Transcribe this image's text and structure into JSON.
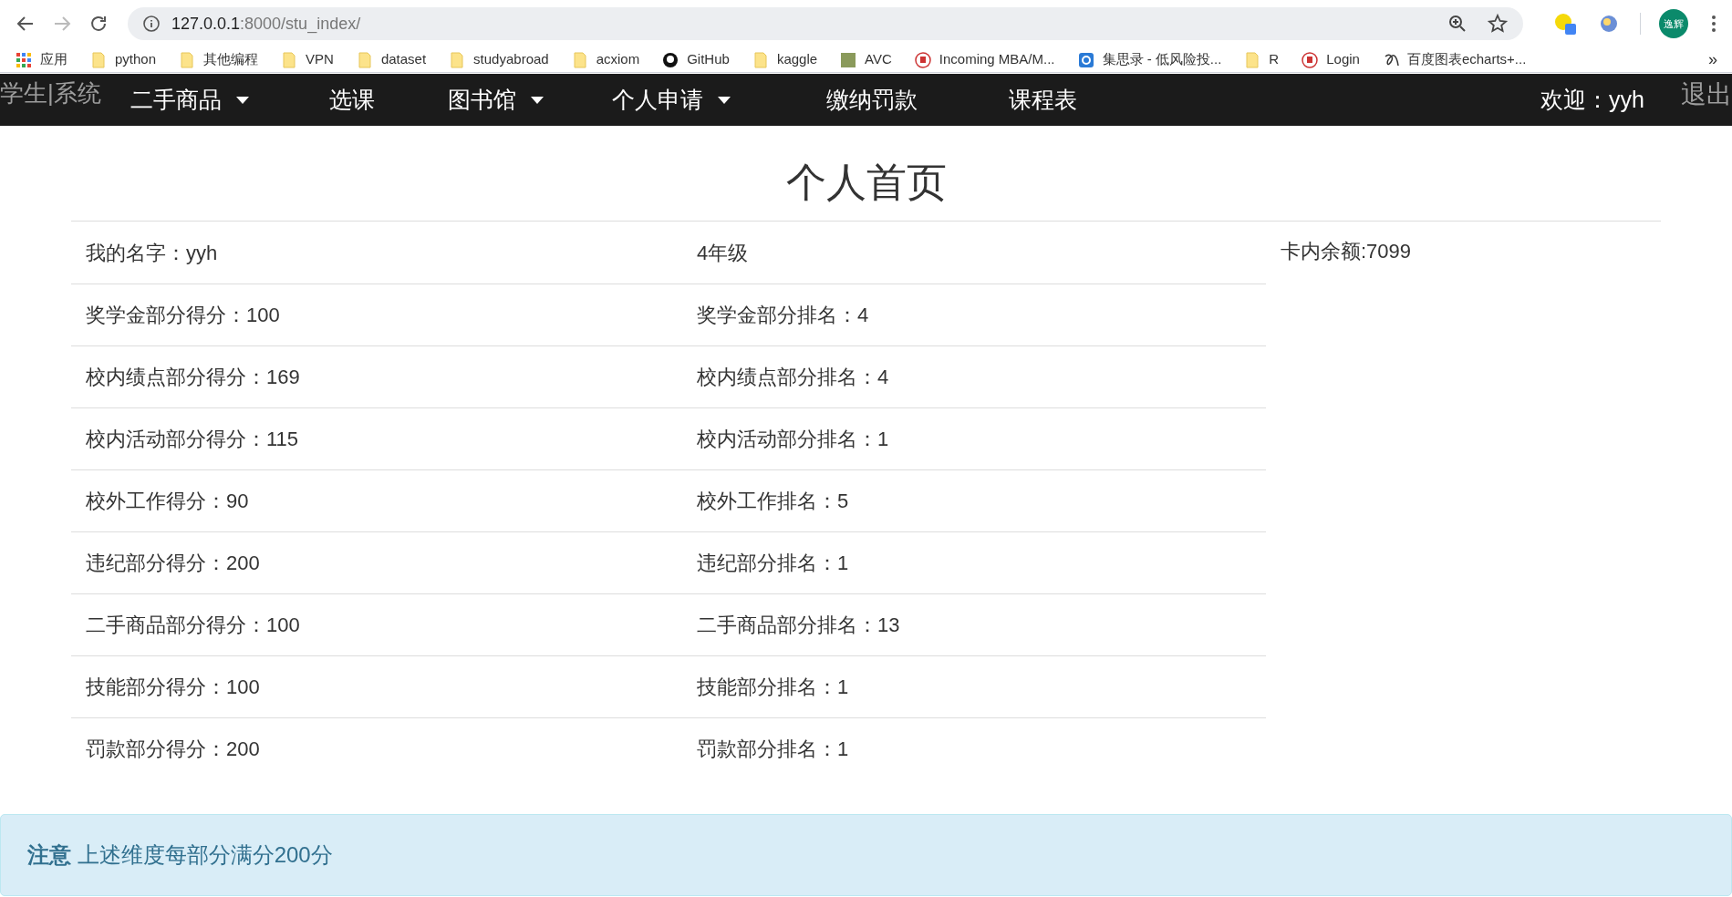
{
  "browser": {
    "url_host": "127.0.0.1",
    "url_path": ":8000/stu_index/",
    "profile": "逸辉",
    "bookmarks": [
      {
        "label": "应用",
        "kind": "apps"
      },
      {
        "label": "python",
        "kind": "folder"
      },
      {
        "label": "其他编程",
        "kind": "folder"
      },
      {
        "label": "VPN",
        "kind": "folder"
      },
      {
        "label": "dataset",
        "kind": "folder"
      },
      {
        "label": "studyabroad",
        "kind": "folder"
      },
      {
        "label": "acxiom",
        "kind": "folder"
      },
      {
        "label": "GitHub",
        "kind": "github"
      },
      {
        "label": "kaggle",
        "kind": "folder"
      },
      {
        "label": "AVC",
        "kind": "image"
      },
      {
        "label": "Incoming MBA/M...",
        "kind": "seal"
      },
      {
        "label": "集思录 - 低风险投...",
        "kind": "blue"
      },
      {
        "label": "R",
        "kind": "folder"
      },
      {
        "label": "Login",
        "kind": "seal"
      },
      {
        "label": "百度图表echarts+...",
        "kind": "glyph"
      }
    ],
    "more": "»"
  },
  "navbar": {
    "brand": "学生|系统",
    "items": [
      {
        "label": "二手商品",
        "dropdown": true
      },
      {
        "label": "选课",
        "dropdown": false
      },
      {
        "label": "图书馆",
        "dropdown": true
      },
      {
        "label": "个人申请",
        "dropdown": true
      },
      {
        "label": "缴纳罚款",
        "dropdown": false
      },
      {
        "label": "课程表",
        "dropdown": false
      }
    ],
    "welcome": "欢迎：yyh",
    "logout": "退出"
  },
  "title": "个人首页",
  "balance": "卡内余额:7099",
  "rows": [
    {
      "score": "我的名字：yyh",
      "rank": "4年级"
    },
    {
      "score": "奖学金部分得分：100",
      "rank": "奖学金部分排名：4"
    },
    {
      "score": "校内绩点部分得分：169",
      "rank": "校内绩点部分排名：4"
    },
    {
      "score": "校内活动部分得分：115",
      "rank": "校内活动部分排名：1"
    },
    {
      "score": "校外工作得分：90",
      "rank": "校外工作排名：5"
    },
    {
      "score": "违纪部分得分：200",
      "rank": "违纪部分排名：1"
    },
    {
      "score": "二手商品部分得分：100",
      "rank": "二手商品部分排名：13"
    },
    {
      "score": "技能部分得分：100",
      "rank": "技能部分排名：1"
    },
    {
      "score": "罚款部分得分：200",
      "rank": "罚款部分排名：1"
    }
  ],
  "alert": {
    "strong": "注意",
    "text": "上述维度每部分满分200分"
  }
}
